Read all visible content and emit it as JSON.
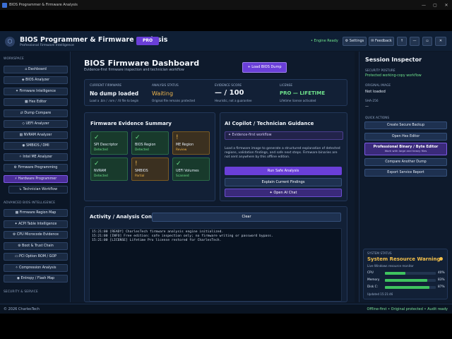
{
  "window": {
    "title": "BIOS Programmer & Firmware Analysis"
  },
  "header": {
    "title": "BIOS Programmer & Firmware Analysis",
    "subtitle": "Professional Firmware Intelligence",
    "badge": "PRO",
    "engine_status": "• Engine Ready",
    "settings_label": "⚙ Settings",
    "feedback_label": "✉ Feedback",
    "up_label": "↑",
    "min_label": "—",
    "max_label": "▫",
    "close_label": "✕"
  },
  "sidebar": {
    "section_workspace": "WORKSPACE",
    "items": [
      "⌂ Dashboard",
      "◈ BIOS Analyzer",
      "✦ Firmware Intelligence",
      "▦ Hex Editor",
      "⇄ Dump Compare",
      "◇ UEFI Analyzer",
      "▤ NVRAM Analyzer",
      "◉ SMBIOS / DMI",
      "✧ Intel ME Analyzer",
      "⚙ Firmware Programming",
      "⚡ Hardware Programmer",
      "↳ Technician Workflow"
    ],
    "section_advanced": "ADVANCED BIOS INTELLIGENCE",
    "advanced_items": [
      "▦ Firmware Region Map",
      "✦ ACPI Table Intelligence",
      "⚙ CPU Microcode Evidence",
      "⚙ Boot & Trust Chain",
      "▭ PCI Option ROM / GOP",
      "✧ Compression Analysis",
      "◉ Entropy / Flash Map"
    ],
    "section_security": "SECURITY & SERVICE"
  },
  "dashboard": {
    "title": "BIOS Firmware Dashboard",
    "subtitle": "Evidence-first firmware inspection and technician workflow",
    "load_button": "+ Load BIOS Dump",
    "stats": [
      {
        "label": "CURRENT FIRMWARE",
        "value": "No dump loaded",
        "note": "Load a .bin / .rom / .fd file to begin"
      },
      {
        "label": "ANALYSIS STATUS",
        "value": "Waiting",
        "note": "Original file remains protected"
      },
      {
        "label": "EVIDENCE SCORE",
        "value": "— / 100",
        "note": "Heuristic, not a guarantee"
      },
      {
        "label": "LICENSE",
        "value": "PRO — LIFETIME",
        "note": "Lifetime license activated"
      }
    ],
    "evidence_title": "Firmware Evidence Summary",
    "tiles": [
      {
        "mark": "✓",
        "name": "SPI Descriptor",
        "status": "Detected"
      },
      {
        "mark": "✓",
        "name": "BIOS Region",
        "status": "Detected"
      },
      {
        "mark": "!",
        "name": "ME Region",
        "status": "Review"
      },
      {
        "mark": "✓",
        "name": "NVRAM",
        "status": "Detected"
      },
      {
        "mark": "!",
        "name": "SMBIOS",
        "status": "Partial"
      },
      {
        "mark": "✓",
        "name": "UEFI Volumes",
        "status": "Scanned"
      }
    ],
    "copilot_title": "AI Copilot / Technician Guidance",
    "copilot_badge": "✦ Evidence-first workflow",
    "copilot_text": "Load a firmware image to generate a structured explanation of detected regions, validation findings, and safe next steps. Firmware binaries are not sent anywhere by this offline edition.",
    "run_button": "Run Safe Analysis",
    "explain_button": "Explain Current Findings",
    "chat_button": "✦ Open AI Chat",
    "console_title": "Activity / Analysis Console",
    "clear_button": "Clear",
    "console_lines": [
      "15:21:00  [READY] CharlesTech firmware analysis engine initialized.",
      "15:21:00  [INFO] Free edition: safe inspection only; no firmware writing or password bypass.",
      "15:21:00  [LICENSE] Lifetime Pro license restored for CharlesTech."
    ]
  },
  "inspector": {
    "title": "Session Inspector",
    "posture_label": "SECURITY POSTURE",
    "posture_value": "Protected working-copy workflow",
    "original_label": "ORIGINAL IMAGE",
    "original_value": "Not loaded",
    "sha_label": "SHA-256",
    "sha_value": "—",
    "quick_label": "QUICK ACTIONS",
    "btn_backup": "Create Secure Backup",
    "btn_hex": "Open Hex Editor",
    "btn_pro_title": "Professional Binary / Byte Editor",
    "btn_pro_sub": "Work with large and heavy files",
    "btn_compare": "Compare Another Dump",
    "btn_export": "Export Service Report",
    "status_label": "SYSTEM STATUS",
    "status_title": "System Resource Warning",
    "status_sub": "Live Windows resource monitor",
    "status_dot": "#f4c04a",
    "resources": [
      {
        "name": "CPU",
        "pct": 40,
        "label": "40%"
      },
      {
        "name": "Memory",
        "pct": 83,
        "label": "83%"
      },
      {
        "name": "Disk C:",
        "pct": 87,
        "label": "87%"
      }
    ],
    "updated": "Updated 15:21:46"
  },
  "footer": {
    "left": "© 2026 CharlesTech",
    "right": "Offline-first • Original protected • Audit ready"
  }
}
